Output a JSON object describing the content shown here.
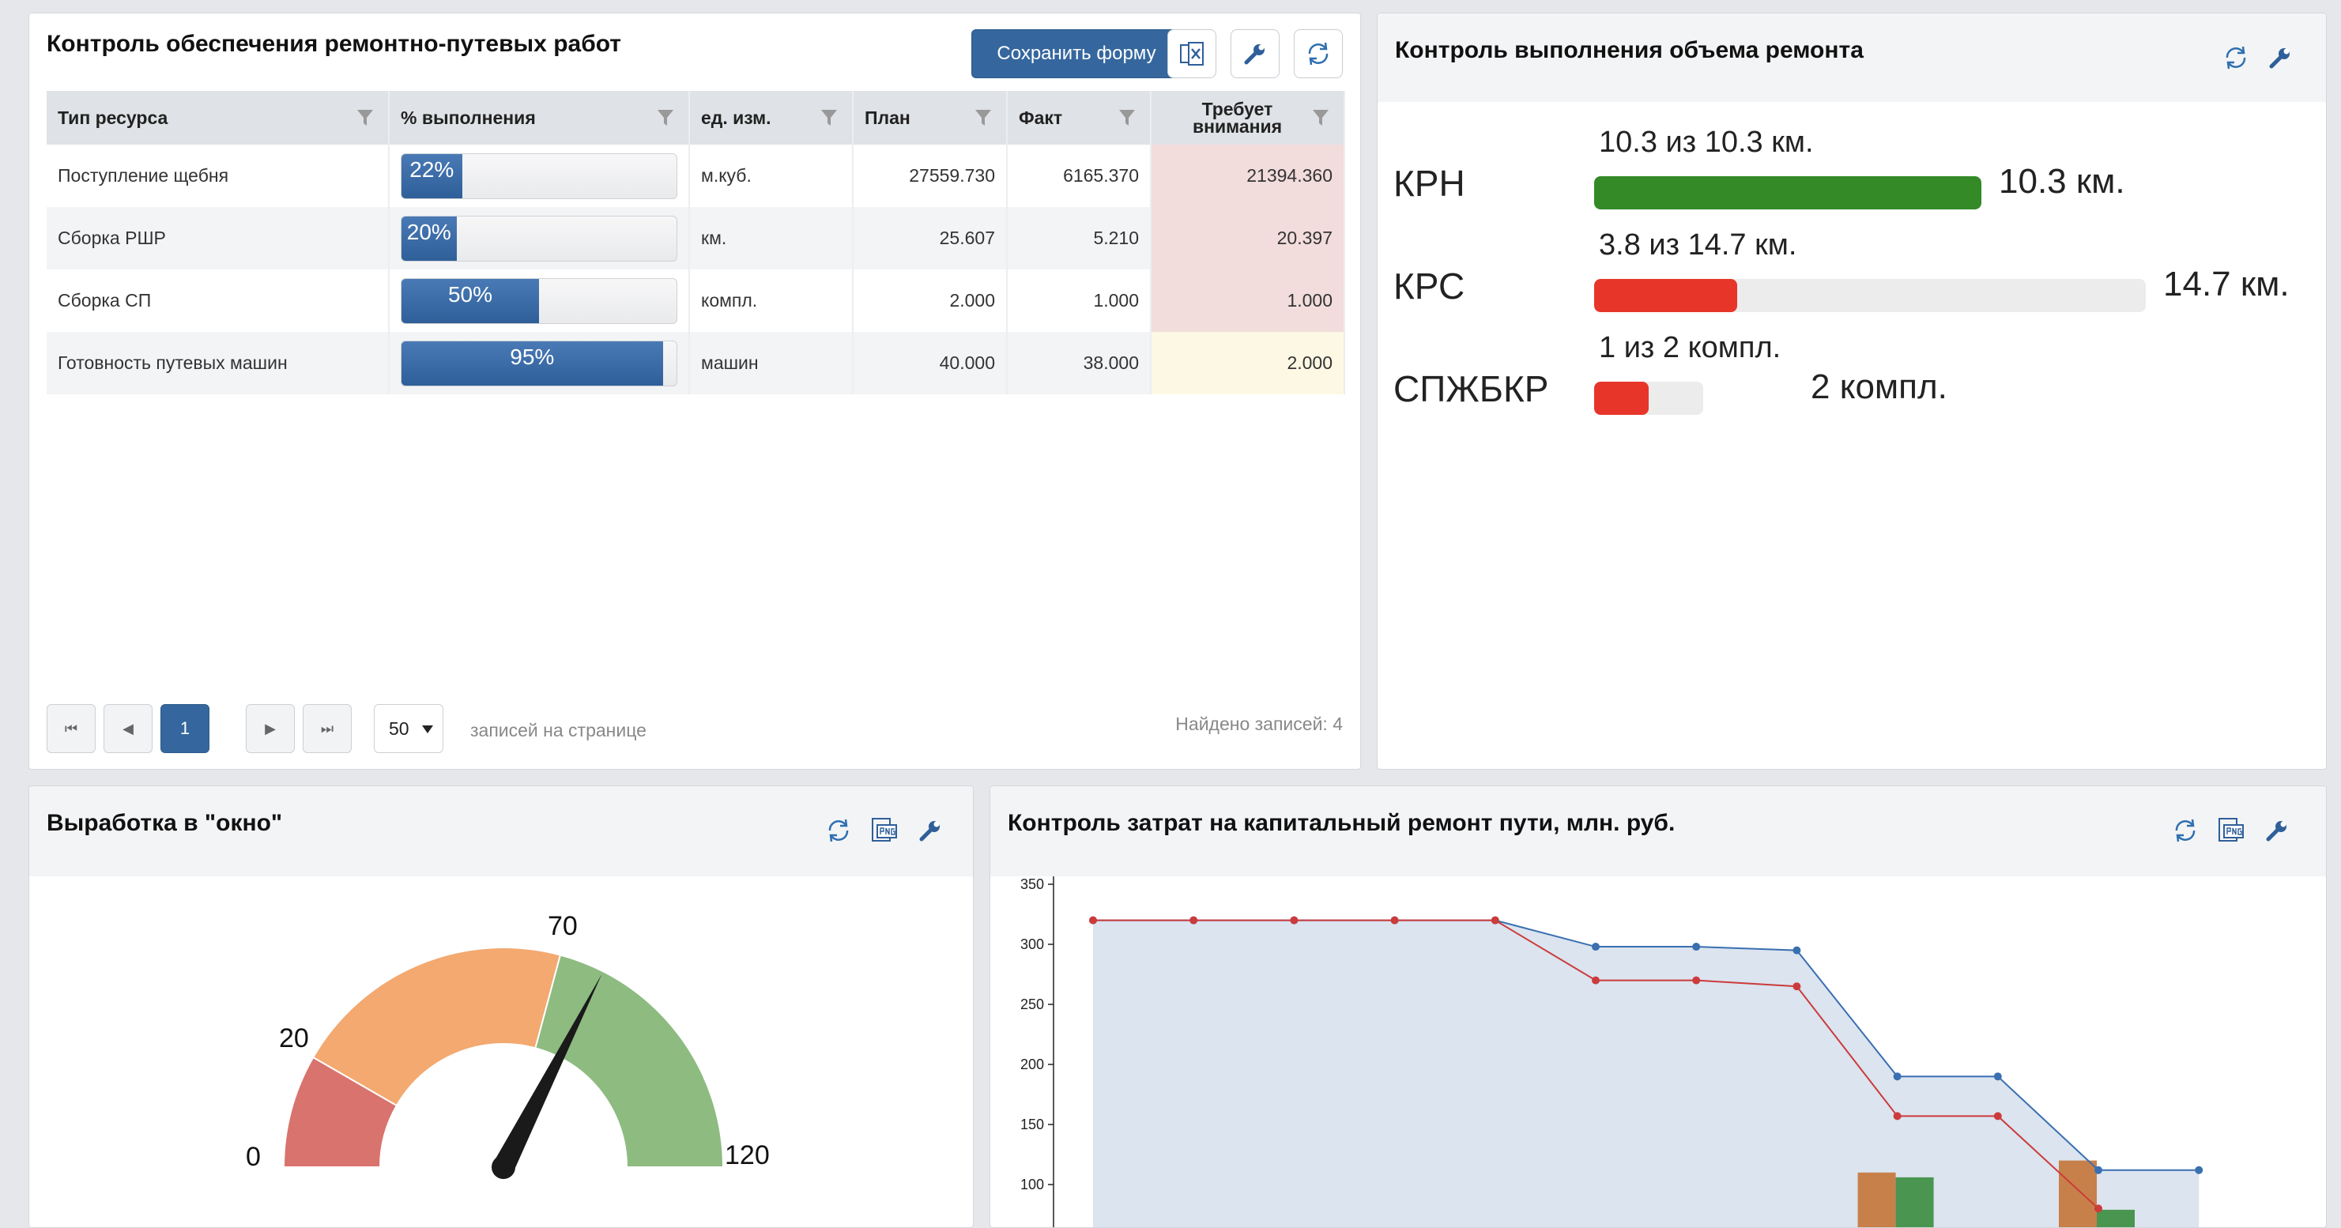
{
  "supply_panel": {
    "title": "Контроль обеспечения ремонтно-путевых работ",
    "save_label": "Сохранить форму",
    "columns": [
      "Тип ресурса",
      "% выполнения",
      "ед. изм.",
      "План",
      "Факт",
      "Требует внимания"
    ],
    "rows": [
      {
        "name": "Поступление щебня",
        "percent_label": "22%",
        "percent": 22,
        "unit": "м.куб.",
        "plan": "27559.730",
        "fact": "6165.370",
        "attention": "21394.360",
        "attention_status": "red"
      },
      {
        "name": "Сборка РШР",
        "percent_label": "20%",
        "percent": 20,
        "unit": "км.",
        "plan": "25.607",
        "fact": "5.210",
        "attention": "20.397",
        "attention_status": "red"
      },
      {
        "name": "Сборка СП",
        "percent_label": "50%",
        "percent": 50,
        "unit": "компл.",
        "plan": "2.000",
        "fact": "1.000",
        "attention": "1.000",
        "attention_status": "red"
      },
      {
        "name": "Готовность путевых машин",
        "percent_label": "95%",
        "percent": 95,
        "unit": "машин",
        "plan": "40.000",
        "fact": "38.000",
        "attention": "2.000",
        "attention_status": "yellow"
      }
    ],
    "pager": {
      "current_page": "1",
      "page_size": "50",
      "page_size_label": "записей на странице",
      "found_label": "Найдено записей: 4"
    }
  },
  "repair_volume_panel": {
    "title": "Контроль выполнения объема ремонта",
    "items": [
      {
        "label": "КРН",
        "sub": "10.3 из 10.3 км.",
        "max_label": "10.3 км.",
        "fraction": 1.0,
        "color": "#338a27"
      },
      {
        "label": "КРС",
        "sub": "3.8 из 14.7 км.",
        "max_label": "14.7 км.",
        "fraction": 0.26,
        "color": "#e8352a"
      },
      {
        "label": "СПЖБКР",
        "sub": "1 из 2 компл.",
        "max_label": "2 компл.",
        "fraction": 0.5,
        "color": "#e8352a"
      }
    ]
  },
  "window_panel": {
    "title": "Выработка в \"окно\"",
    "gauge": {
      "min_label": "0",
      "t1_label": "20",
      "t2_label": "70",
      "max_label": "120",
      "min": 0,
      "max": 120,
      "value": 78,
      "bands": [
        {
          "from": 0,
          "to": 20,
          "color": "#d9736d"
        },
        {
          "from": 20,
          "to": 70,
          "color": "#f3a970"
        },
        {
          "from": 70,
          "to": 120,
          "color": "#8dbb80"
        }
      ]
    }
  },
  "costs_panel": {
    "title": "Контроль затрат на капитальный ремонт пути, млн. руб."
  },
  "chart_data": {
    "type": "line",
    "title": "Контроль затрат на капитальный ремонт пути, млн. руб.",
    "ylim": [
      0,
      350
    ],
    "yticks": [
      100,
      150,
      200,
      250,
      300,
      350
    ],
    "series": [
      {
        "color": "#3a6fb0",
        "area": true,
        "values": [
          320,
          320,
          320,
          320,
          320,
          298,
          298,
          295,
          190,
          190,
          112,
          112
        ]
      },
      {
        "color": "#cc3b3b",
        "values": [
          320,
          320,
          320,
          320,
          320,
          270,
          270,
          265,
          157,
          157,
          80,
          null
        ]
      }
    ],
    "bars": [
      {
        "index": 8,
        "values": [
          110,
          106
        ],
        "colors": [
          "#c8804a",
          "#4a9650"
        ]
      },
      {
        "index": 10,
        "values": [
          120,
          79
        ],
        "colors": [
          "#c8804a",
          "#4a9650"
        ]
      }
    ]
  }
}
